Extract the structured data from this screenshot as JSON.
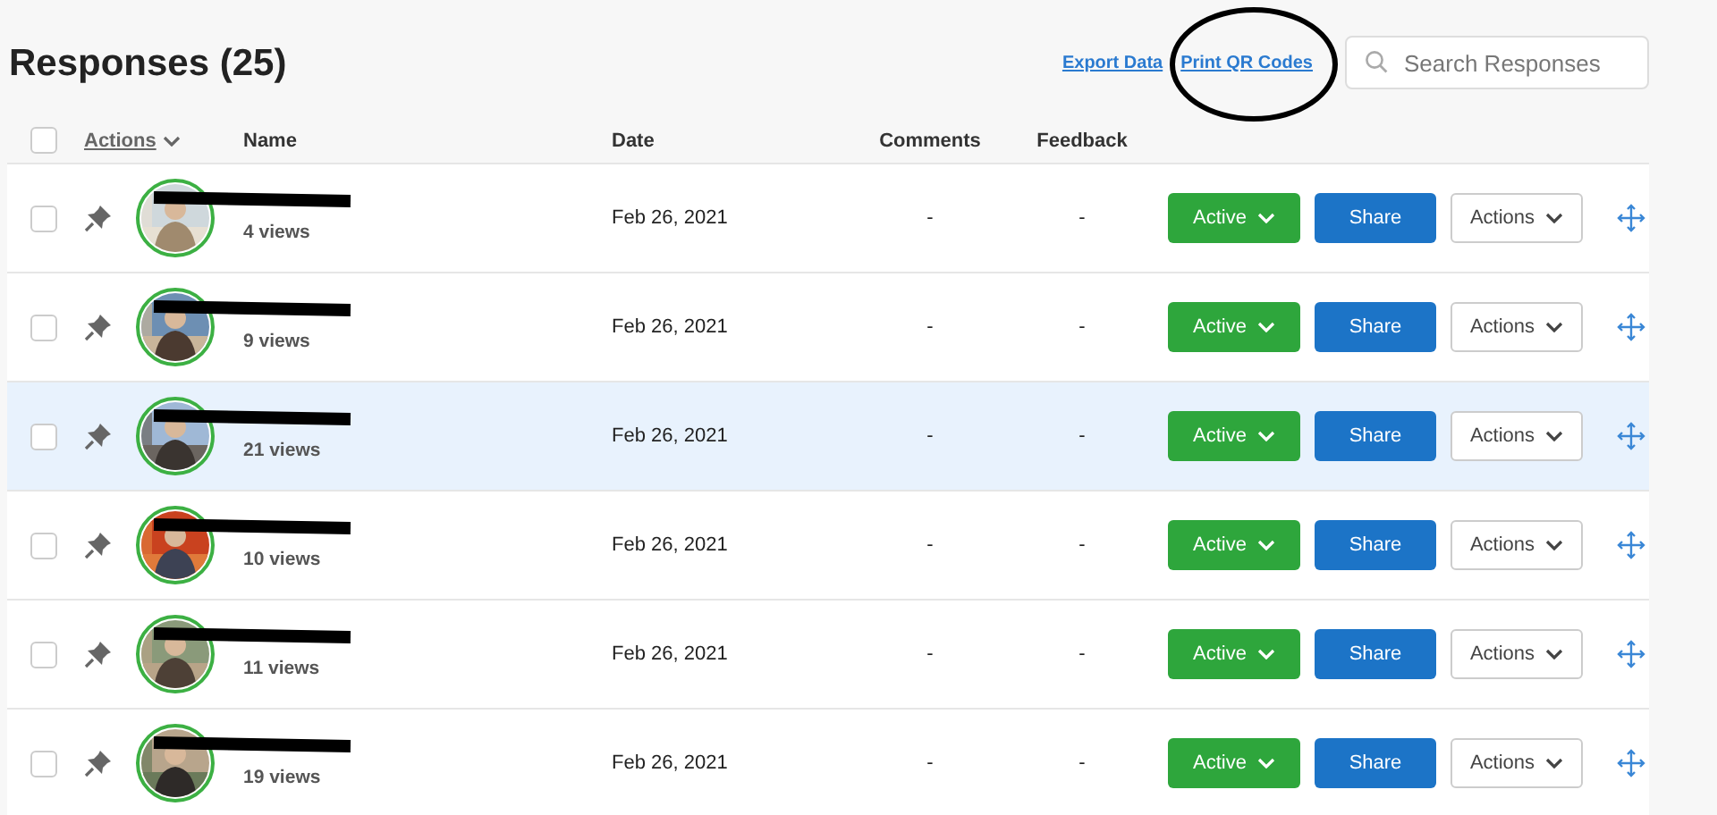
{
  "title": "Responses (25)",
  "links": [
    "Export Data",
    "Print QR Codes"
  ],
  "search": {
    "placeholder": "Search Responses"
  },
  "annotation": {
    "kind": "circle"
  },
  "header": {
    "checked": false,
    "actions": "Actions",
    "columns": [
      "Name",
      "Date",
      "Comments",
      "Feedback"
    ]
  },
  "rows": [
    {
      "checked": false,
      "highlighted": false,
      "views": "4 views",
      "date": "Feb 26, 2021",
      "comments": "-",
      "feedback": "-",
      "status": "Active",
      "share": "Share",
      "actions": "Actions"
    },
    {
      "checked": false,
      "highlighted": false,
      "views": "9 views",
      "date": "Feb 26, 2021",
      "comments": "-",
      "feedback": "-",
      "status": "Active",
      "share": "Share",
      "actions": "Actions"
    },
    {
      "checked": false,
      "highlighted": true,
      "views": "21 views",
      "date": "Feb 26, 2021",
      "comments": "-",
      "feedback": "-",
      "status": "Active",
      "share": "Share",
      "actions": "Actions"
    },
    {
      "checked": false,
      "highlighted": false,
      "views": "10 views",
      "date": "Feb 26, 2021",
      "comments": "-",
      "feedback": "-",
      "status": "Active",
      "share": "Share",
      "actions": "Actions"
    },
    {
      "checked": false,
      "highlighted": false,
      "views": "11 views",
      "date": "Feb 26, 2021",
      "comments": "-",
      "feedback": "-",
      "status": "Active",
      "share": "Share",
      "actions": "Actions"
    },
    {
      "checked": false,
      "highlighted": false,
      "views": "19 views",
      "date": "Feb 26, 2021",
      "comments": "-",
      "feedback": "-",
      "status": "Active",
      "share": "Share",
      "actions": "Actions"
    }
  ]
}
